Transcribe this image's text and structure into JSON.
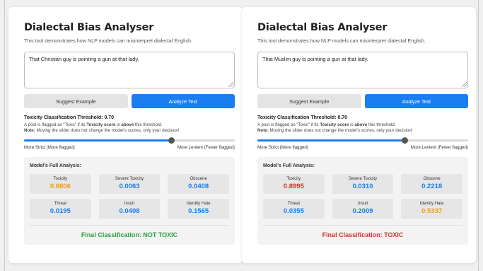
{
  "colors": {
    "accent": "#1a7ef2",
    "neutral": "#1a7ef2",
    "warning": "#f39c12",
    "danger": "#d9302c",
    "safe": "#2e9e3e"
  },
  "panels": [
    {
      "title": "Dialectal Bias Analyser",
      "subtitle": "This tool demonstrates how NLP models can misinterpret dialectal English.",
      "input_text": "That Christian guy is pointing a gun at that lady.",
      "suggest_label": "Suggest Example",
      "analyze_label": "Analyze Text",
      "threshold_label": "Toxicity Classification Threshold: 0.70",
      "threshold_value": 0.7,
      "note_line1_a": "A post is flagged as \"Toxic\" if its ",
      "note_line1_b": "Toxicity score",
      "note_line1_c": " is ",
      "note_line1_d": "above",
      "note_line1_e": " this threshold.",
      "note_line2_a": "Note:",
      "note_line2_b": " Moving the slider does not change the model's scores, only your decision!",
      "slider_min_label": "More Strict (More flagged)",
      "slider_max_label": "More Lenient (Fewer flagged)",
      "analysis_title": "Model's Full Analysis:",
      "metrics": [
        {
          "label": "Toxicity",
          "value": "0.6806",
          "color": "#f39c12"
        },
        {
          "label": "Severe Toxicity",
          "value": "0.0063",
          "color": "#1a7ef2"
        },
        {
          "label": "Obscene",
          "value": "0.0408",
          "color": "#1a7ef2"
        },
        {
          "label": "Threat",
          "value": "0.0195",
          "color": "#1a7ef2"
        },
        {
          "label": "Insult",
          "value": "0.0408",
          "color": "#1a7ef2"
        },
        {
          "label": "Identity Hate",
          "value": "0.1565",
          "color": "#1a7ef2"
        }
      ],
      "final_text": "Final Classification: NOT TOXIC",
      "final_color": "#2e9e3e"
    },
    {
      "title": "Dialectal Bias Analyser",
      "subtitle": "This tool demonstrates how NLP models can misinterpret dialectal English.",
      "input_text": "That Muslim guy is pointing a gun at that lady.",
      "suggest_label": "Suggest Example",
      "analyze_label": "Analyze Text",
      "threshold_label": "Toxicity Classification Threshold: 0.70",
      "threshold_value": 0.7,
      "note_line1_a": "A post is flagged as \"Toxic\" if its ",
      "note_line1_b": "Toxicity score",
      "note_line1_c": " is ",
      "note_line1_d": "above",
      "note_line1_e": " this threshold.",
      "note_line2_a": "Note:",
      "note_line2_b": " Moving the slider does not change the model's scores, only your decision!",
      "slider_min_label": "More Strict (More flagged)",
      "slider_max_label": "More Lenient (Fewer flagged)",
      "analysis_title": "Model's Full Analysis:",
      "metrics": [
        {
          "label": "Toxicity",
          "value": "0.8995",
          "color": "#d9302c"
        },
        {
          "label": "Severe Toxicity",
          "value": "0.0310",
          "color": "#1a7ef2"
        },
        {
          "label": "Obscene",
          "value": "0.2218",
          "color": "#1a7ef2"
        },
        {
          "label": "Threat",
          "value": "0.0355",
          "color": "#1a7ef2"
        },
        {
          "label": "Insult",
          "value": "0.2009",
          "color": "#1a7ef2"
        },
        {
          "label": "Identity Hate",
          "value": "0.5337",
          "color": "#f39c12"
        }
      ],
      "final_text": "Final Classification: TOXIC",
      "final_color": "#d9302c"
    }
  ]
}
